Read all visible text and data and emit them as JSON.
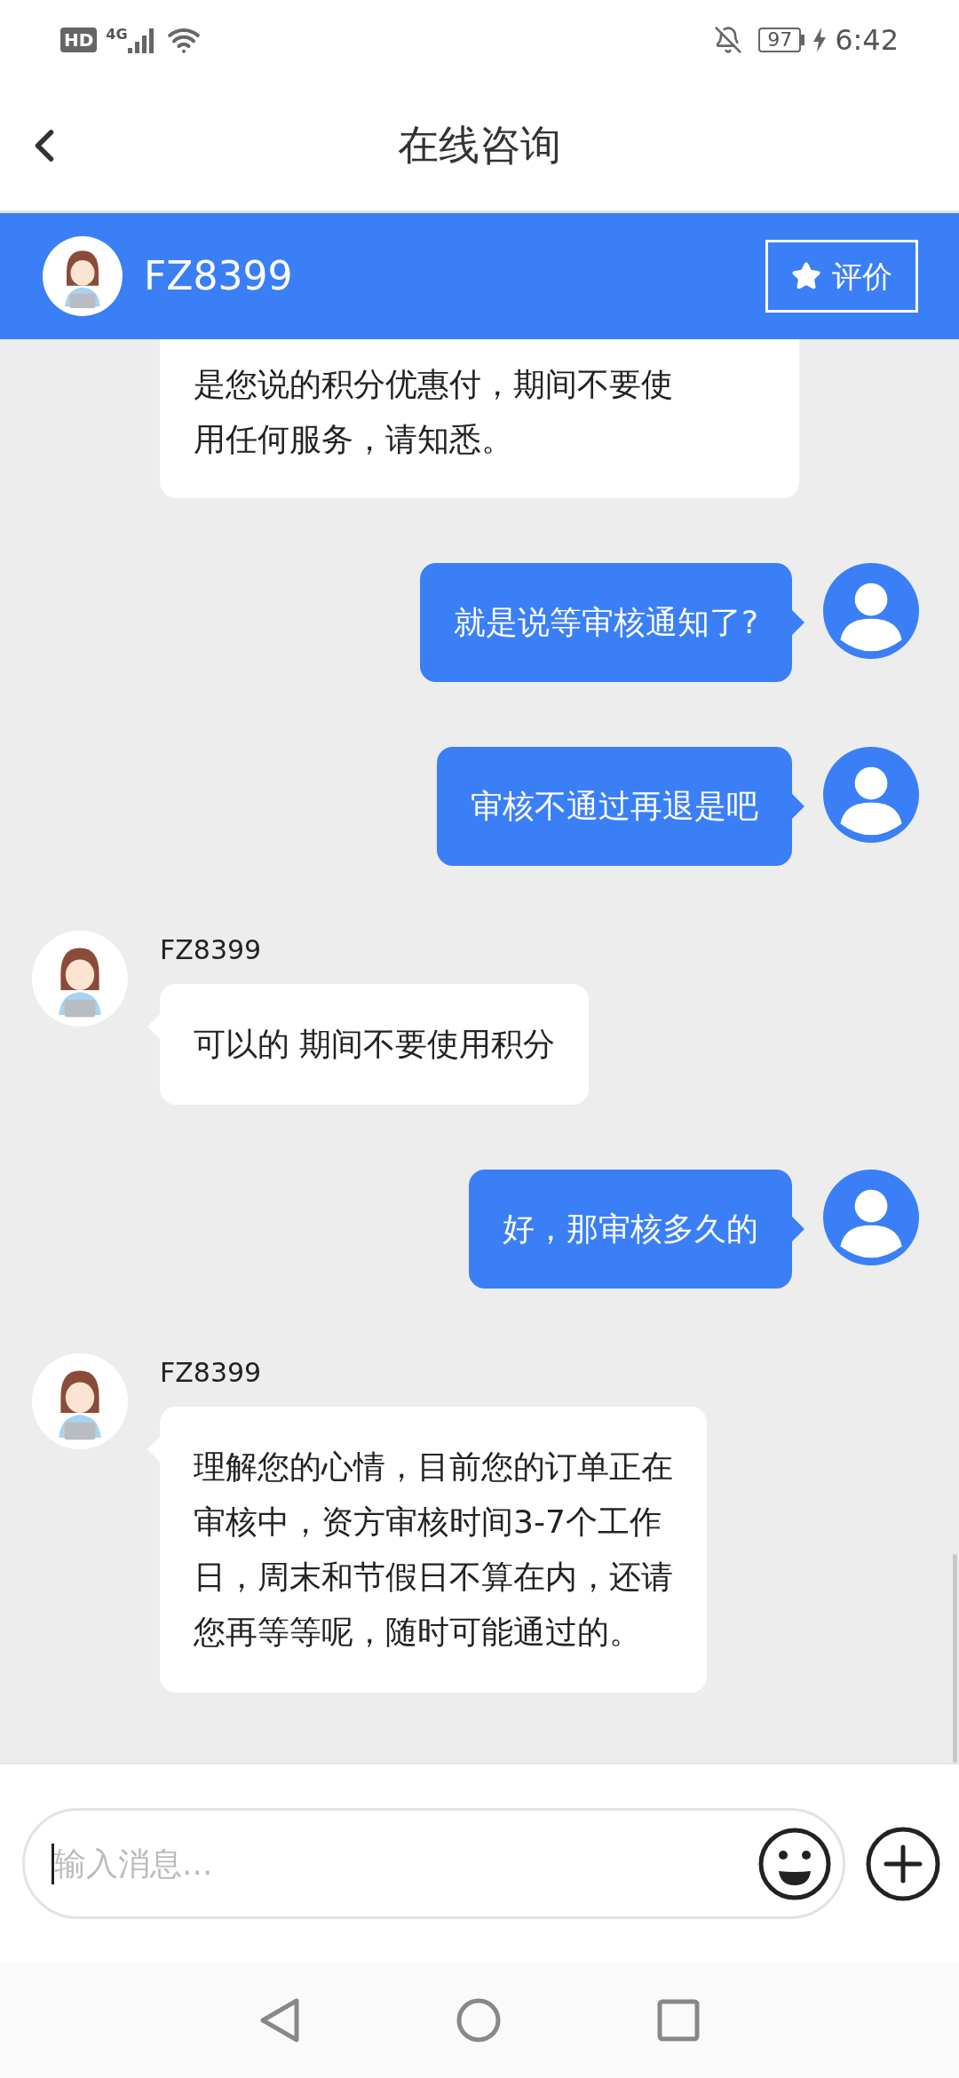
{
  "status_bar": {
    "hd": "HD",
    "network": "4G",
    "battery": "97",
    "time": "6:42"
  },
  "title_bar": {
    "title": "在线咨询"
  },
  "agent_header": {
    "name": "FZ8399",
    "rate_button": "评价"
  },
  "messages": [
    {
      "kind": "agent",
      "lines": [
        "是您说的积分优惠付，期间不要使",
        "用任何服务，请知悉。"
      ]
    },
    {
      "kind": "user",
      "lines": [
        "就是说等审核通知了?"
      ]
    },
    {
      "kind": "user",
      "lines": [
        "审核不通过再退是吧"
      ]
    },
    {
      "kind": "agent",
      "sender": "FZ8399",
      "lines": [
        "可以的 期间不要使用积分"
      ]
    },
    {
      "kind": "user",
      "lines": [
        "好，那审核多久的"
      ]
    },
    {
      "kind": "agent",
      "sender": "FZ8399",
      "lines": [
        "理解您的心情，目前您的订单正在",
        "审核中，资方审核时间3-7个工作",
        "日，周末和节假日不算在内，还请",
        "您再等等呢，随时可能通过的。"
      ]
    }
  ],
  "input": {
    "placeholder": "输入消息..."
  }
}
